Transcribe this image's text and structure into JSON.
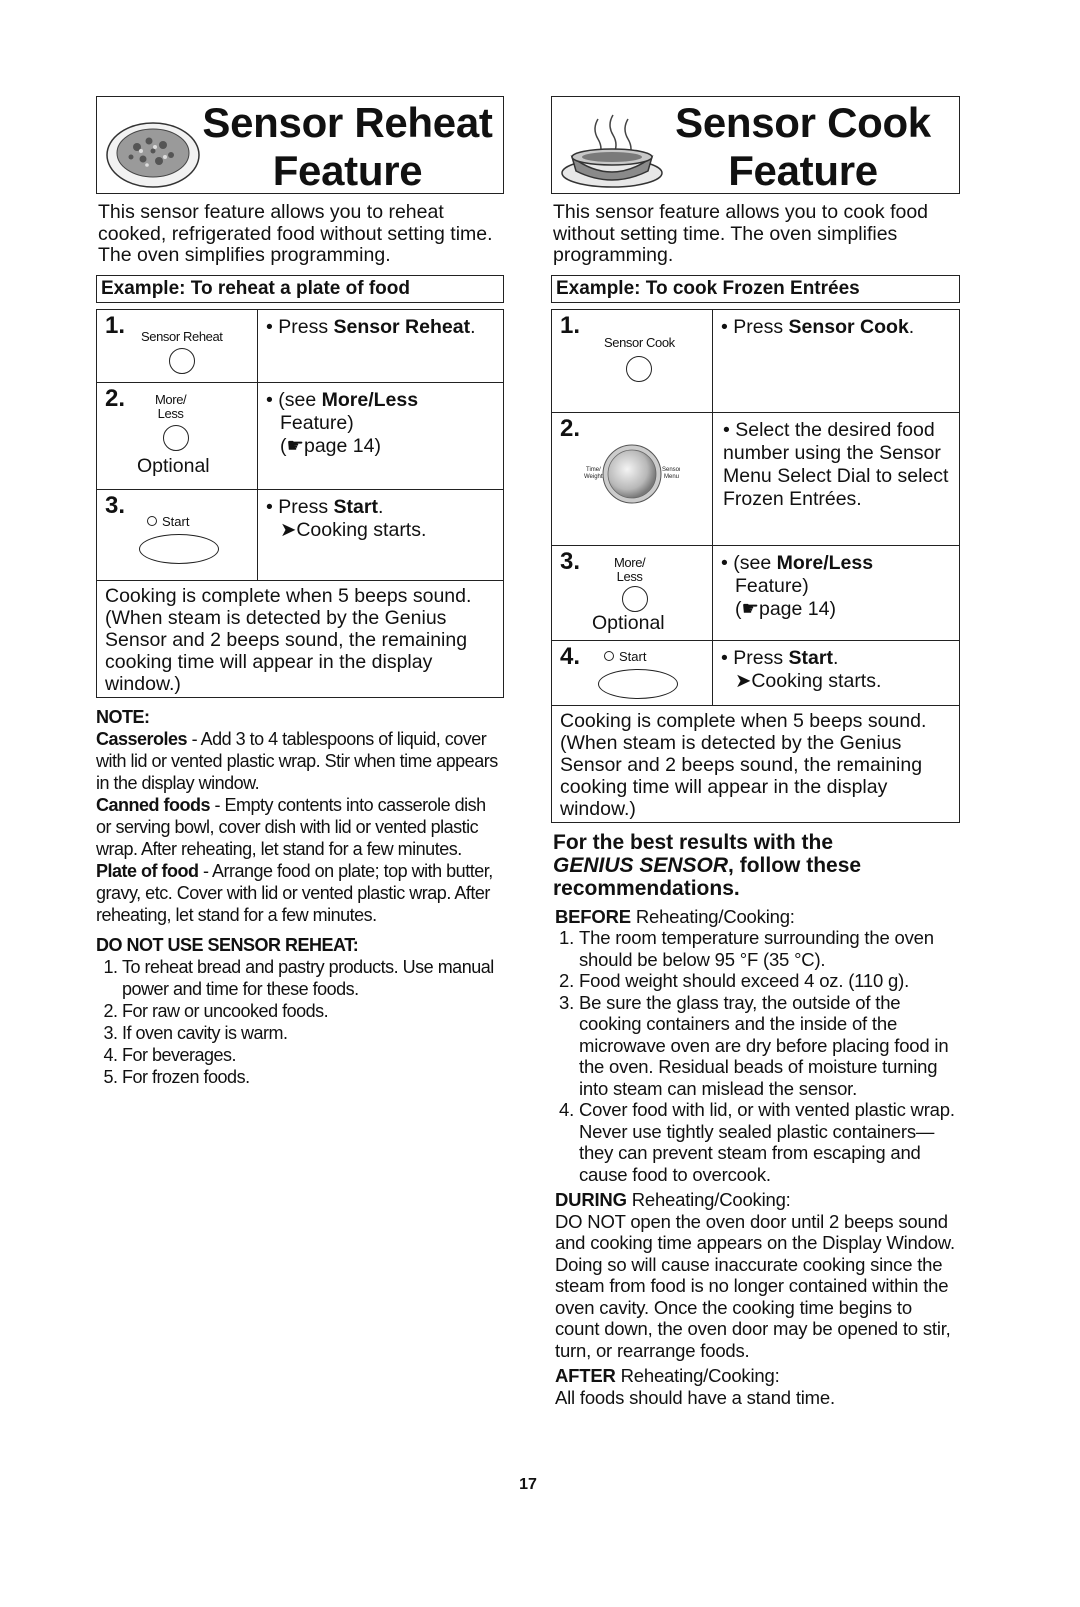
{
  "left": {
    "title_line1": "Sensor Reheat",
    "title_line2": "Feature",
    "icon": "plate-of-food-icon",
    "intro": "This sensor feature allows you to reheat cooked, refrigerated food without setting time. The oven simplifies programming.",
    "example": "Example: To reheat a plate of food",
    "steps": [
      {
        "num": "1.",
        "pad_label": "Sensor Reheat",
        "text_pre": "• Press ",
        "text_bold": "Sensor Reheat",
        "text_post": "."
      },
      {
        "num": "2.",
        "pad_label_1": "More/",
        "pad_label_2": "Less",
        "optional": "Optional",
        "text_pre": "• (see ",
        "text_bold": "More/Less",
        "line2": "Feature)",
        "line3": "(☛page 14)"
      },
      {
        "num": "3.",
        "pad_label": "Start",
        "text_pre": "• Press ",
        "text_bold": "Start",
        "text_post": ".",
        "line2": "➤Cooking starts."
      }
    ],
    "complete": "Cooking is complete when 5 beeps sound. (When steam is detected by the Genius Sensor and 2 beeps sound, the remaining cooking time will appear in the display window.)",
    "note_head": "NOTE:",
    "notes": [
      {
        "term": "Casseroles",
        "text": " - Add 3 to 4 tablespoons of liquid, cover with lid or vented plastic wrap. Stir when time appears in the display window."
      },
      {
        "term": "Canned foods",
        "text": " - Empty contents into casserole dish or serving bowl, cover dish with lid or vented plastic wrap. After reheating, let stand for a few minutes."
      },
      {
        "term": "Plate of food",
        "text": " - Arrange food on plate; top with butter, gravy, etc. Cover with lid or vented plastic wrap. After reheating, let stand for a few minutes."
      }
    ],
    "dnu_head": "DO NOT USE SENSOR REHEAT:",
    "dnu": [
      "To reheat bread and pastry products. Use manual power and time for these foods.",
      "For raw or uncooked foods.",
      "If oven cavity is warm.",
      "For beverages.",
      "For frozen foods."
    ]
  },
  "right": {
    "title_line1": "Sensor Cook",
    "title_line2": "Feature",
    "icon": "steaming-bowl-icon",
    "intro": "This sensor feature allows you to cook food without setting time. The oven simplifies programming.",
    "example": "Example: To cook Frozen Entrées",
    "steps": [
      {
        "num": "1.",
        "pad_label": "Sensor Cook",
        "text_pre": "• Press ",
        "text_bold": "Sensor Cook",
        "text_post": "."
      },
      {
        "num": "2.",
        "dial_left": "Time/ Weight",
        "dial_right": "Sensor Menu",
        "text": "• Select the desired food number using the Sensor Menu Select Dial to select Frozen Entrées."
      },
      {
        "num": "3.",
        "pad_label_1": "More/",
        "pad_label_2": "Less",
        "optional": "Optional",
        "text_pre": "• (see ",
        "text_bold": "More/Less",
        "line2": "Feature)",
        "line3": "(☛page 14)"
      },
      {
        "num": "4.",
        "pad_label": "Start",
        "text_pre": "• Press ",
        "text_bold": "Start",
        "text_post": ".",
        "line2": "➤Cooking starts."
      }
    ],
    "complete": "Cooking is complete when 5 beeps sound. (When steam is detected by the Genius Sensor and 2 beeps sound, the remaining cooking time will appear in the display window.)",
    "best_head_1": "For the best results with the",
    "best_head_italic": "GENIUS SENSOR",
    "best_head_2": ", follow these recommendations.",
    "before_term": "BEFORE",
    "before_rest": " Reheating/Cooking:",
    "before_list": [
      "The room temperature surrounding the oven should be below 95 °F (35 °C).",
      "Food weight should exceed 4 oz. (110 g).",
      "Be sure the glass tray, the outside of the cooking containers and the inside of the microwave oven are dry before placing food in the oven. Residual beads of moisture turning into steam can mislead the sensor.",
      "Cover food with lid, or with vented plastic wrap. Never use tightly sealed plastic containers—they can prevent steam from escaping and cause food to overcook."
    ],
    "during_term": "DURING",
    "during_rest": " Reheating/Cooking:",
    "during_text": "DO NOT open the oven door until 2 beeps sound and cooking time appears on the Display Window.  Doing so will cause inaccurate cooking since the steam from food is no longer contained within the oven cavity. Once the cooking time begins to count down, the oven door may be opened to stir, turn, or rearrange foods.",
    "after_term": "AFTER",
    "after_rest": " Reheating/Cooking:",
    "after_text": "All foods should have a stand time."
  },
  "page_number": "17"
}
